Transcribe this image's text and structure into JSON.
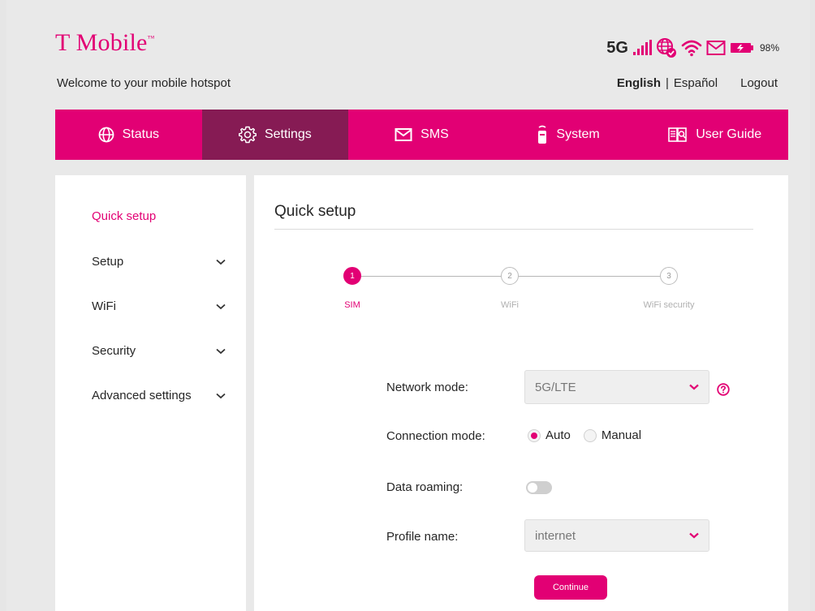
{
  "header": {
    "brand": "T Mobile",
    "brand_mark": "™",
    "welcome": "Welcome to your mobile hotspot",
    "network_type": "5G",
    "battery_percent": "98%",
    "lang_active": "English",
    "lang_sep": "|",
    "lang_other": "Español",
    "logout": "Logout"
  },
  "nav": {
    "items": [
      {
        "label": "Status",
        "icon": "globe-icon"
      },
      {
        "label": "Settings",
        "icon": "gear-icon"
      },
      {
        "label": "SMS",
        "icon": "envelope-icon"
      },
      {
        "label": "System",
        "icon": "router-icon"
      },
      {
        "label": "User Guide",
        "icon": "book-icon"
      }
    ],
    "active": "Settings"
  },
  "sidebar": {
    "items": [
      {
        "label": "Quick setup",
        "active": true
      },
      {
        "label": "Setup"
      },
      {
        "label": "WiFi"
      },
      {
        "label": "Security"
      },
      {
        "label": "Advanced settings"
      }
    ]
  },
  "main": {
    "title": "Quick setup",
    "steps": [
      {
        "number": "1",
        "label": "SIM",
        "active": true
      },
      {
        "number": "2",
        "label": "WiFi"
      },
      {
        "number": "3",
        "label": "WiFi security"
      }
    ],
    "form": {
      "network_mode_label": "Network mode:",
      "network_mode_value": "5G/LTE",
      "connection_mode_label": "Connection mode:",
      "connection_auto": "Auto",
      "connection_manual": "Manual",
      "connection_selected": "Auto",
      "data_roaming_label": "Data roaming:",
      "data_roaming_on": false,
      "profile_name_label": "Profile name:",
      "profile_name_value": "internet"
    },
    "continue_label": "Continue"
  },
  "colors": {
    "brand": "#e20074",
    "nav_active": "#861b54"
  }
}
